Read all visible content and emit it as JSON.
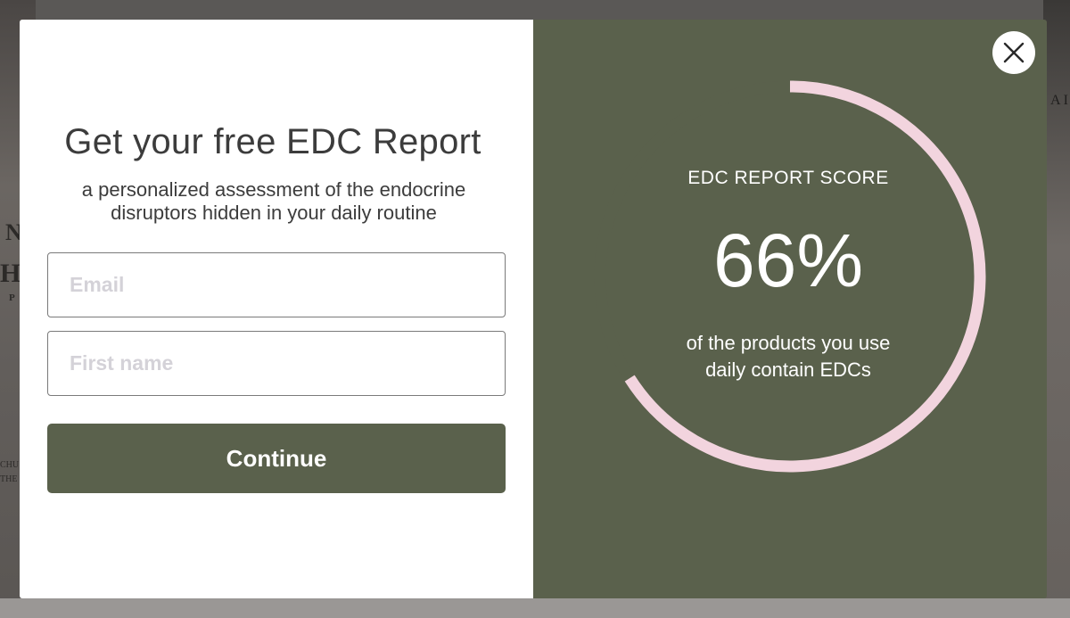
{
  "modal": {
    "title": "Get your free EDC Report",
    "subtitle": "a personalized assessment of the endocrine disruptors hidden in your daily routine",
    "form": {
      "email_placeholder": "Email",
      "first_name_placeholder": "First name",
      "continue_label": "Continue"
    },
    "score": {
      "label": "EDC REPORT SCORE",
      "value": "66%",
      "percent": 66,
      "description": "of the products you use daily contain EDCs"
    },
    "close_icon": "close-icon"
  },
  "colors": {
    "panel_green": "#5a614c",
    "ring_pink": "#f2d4de",
    "white": "#ffffff",
    "title_text": "#3c3c3c",
    "placeholder": "#d4d2d8"
  },
  "backdrop": {
    "fragments": [
      "N",
      "HA",
      "P",
      "CHU",
      "THE",
      "A I"
    ]
  }
}
